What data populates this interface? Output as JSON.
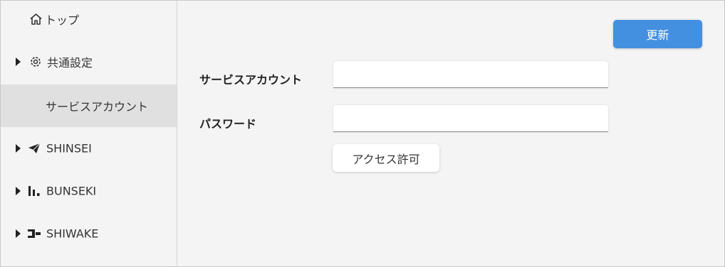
{
  "sidebar": {
    "items": [
      {
        "label": "トップ",
        "icon": "home-icon"
      },
      {
        "label": "共通設定",
        "icon": "gear-icon"
      },
      {
        "label": "サービスアカウント"
      },
      {
        "label": "SHINSEI",
        "icon": "paper-plane-icon"
      },
      {
        "label": "BUNSEKI",
        "icon": "bar-chart-icon"
      },
      {
        "label": "SHIWAKE",
        "icon": "connector-icon"
      }
    ]
  },
  "main": {
    "update_button": "更新",
    "service_account_label": "サービスアカウント",
    "service_account_value": "",
    "password_label": "パスワード",
    "password_value": "",
    "access_button": "アクセス許可"
  },
  "colors": {
    "primary": "#4390e0",
    "background": "#f4f4f4",
    "active_item": "#e0e0e0"
  }
}
